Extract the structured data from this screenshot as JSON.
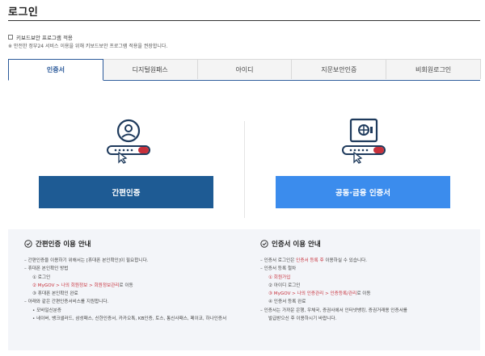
{
  "page_title": "로그인",
  "keyboard_security": {
    "label": "키보드보안 프로그램 적용",
    "note": "※ 안전한 정부24 서비스 이용을 위해 키보드보안 프로그램 적용을 권장합니다."
  },
  "tabs": [
    {
      "label": "인증서"
    },
    {
      "label": "디지털원패스"
    },
    {
      "label": "아이디"
    },
    {
      "label": "지문보안인증"
    },
    {
      "label": "비회원로그인"
    }
  ],
  "buttons": {
    "simple_auth": "간편인증",
    "joint_cert": "공동·금융 인증서"
  },
  "guide_simple": {
    "title": "간편인증 이용 안내",
    "line1": "간편인증을 이용하기 위해서는 [휴대폰 본인확인]이 필요합니다.",
    "line2": "휴대폰 본인확인 방법",
    "step1": "① 로그인",
    "step2_pre": "② MyGOV > 나의 회원정보 > 회원정보관리",
    "step2_post": "로 이동",
    "step3": "③ 휴대폰 본인확인 완료",
    "line3": "아래와 같은 간편인증서비스를 지원합니다.",
    "bullet1": "• 모바일신분증",
    "bullet2": "• 네이버, 뱅크샐러드, 삼성패스, 신한인증서, 카카오톡, KB인증, 토스, 통신사패스, 페이코, 하나인증서"
  },
  "guide_cert": {
    "title": "인증서 이용 안내",
    "line1_pre": "인증서 로그인은 ",
    "line1_red": "인증서 등록 후",
    "line1_post": " 이용하실 수 있습니다.",
    "line2": "인증서 등록 절차",
    "step1": "① 회원가입",
    "step2": "② 아이디 로그인",
    "step3_pre": "③ MyGOV > 나의 인증관리 > 인증등록/관리",
    "step3_post": "로 이동",
    "step4": "④ 인증서 등록 완료",
    "line3": "인증서는 가까운 은행, 우체국, 증권사에서 인터넷뱅킹, 증권거래용 인증서를",
    "line4": "발급받으신 후 이용하시기 바랍니다."
  },
  "colors": {
    "primary_dark": "#1e5b94",
    "primary_light": "#3b8ced",
    "tab_accent": "#2b5a9a",
    "highlight_red": "#c7303b",
    "guide_bg": "#f3f5f9"
  }
}
